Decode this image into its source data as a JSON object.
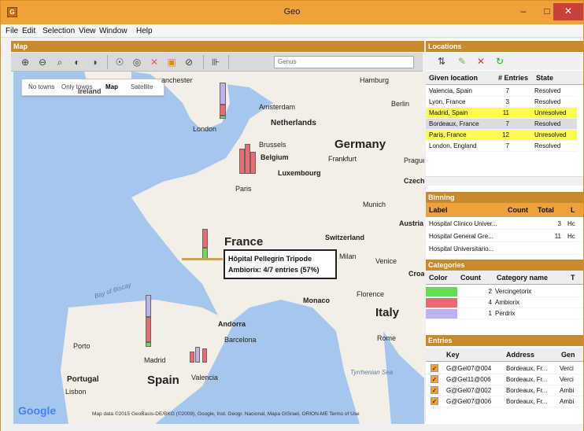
{
  "window": {
    "title": "Geo",
    "icon_label": "G",
    "minimize": "–",
    "maximize": "□",
    "close": "✕"
  },
  "menu": [
    "File",
    "Edit",
    "Selection",
    "View",
    "Window",
    "Help"
  ],
  "map_panel": {
    "title": "Map",
    "genus_placeholder": "Genus",
    "tabs": [
      "No towns",
      "Only towns",
      "Map",
      "Satellite"
    ],
    "selected_tab": "Map",
    "popup_line1": "Hôpital Pellegrin Tripode",
    "popup_line2": "Ambiorix: 4/7 entries (57%)",
    "attribution": "Map data ©2015 GeoBasis-DE/BKG (©2009), Google, Inst. Geogr. Nacional, Mapa GISrael, ORION-ME  Terms of Use",
    "google_logo": "Google",
    "places": {
      "manchester": "anchester",
      "ireland": "Ireland",
      "hamburg": "Hamburg",
      "amsterdam": "Amsterdam",
      "netherlands": "Netherlands",
      "berlin": "Berlin",
      "london": "London",
      "brussels": "Brussels",
      "belgium": "Belgium",
      "germany": "Germany",
      "frankfurt": "Frankfurt",
      "prague": "Prague",
      "luxembourg": "Luxembourg",
      "czech": "Czech",
      "paris": "Paris",
      "munich": "Munich",
      "austria": "Austria",
      "france": "France",
      "switzerland": "Switzerland",
      "milan": "Milan",
      "venice": "Venice",
      "croatia": "Croa",
      "monaco": "Monaco",
      "florence": "Florence",
      "andorra": "Andorra",
      "italy": "Italy",
      "barcelona": "Barcelona",
      "rome": "Rome",
      "porto": "Porto",
      "madrid": "Madrid",
      "portugal": "Portugal",
      "spain": "Spain",
      "valencia": "Valencia",
      "lisbon": "Lisbon",
      "tyrrhenian": "Tyrrhenian Sea",
      "biscay": "Bay of Biscay"
    }
  },
  "locations": {
    "title": "Locations",
    "columns": [
      "Given location",
      "# Entries",
      "State"
    ],
    "rows": [
      {
        "location": "Valencia, Spain",
        "entries": "7",
        "state": "Resolved"
      },
      {
        "location": "Lyon, France",
        "entries": "3",
        "state": "Resolved"
      },
      {
        "location": "Madrid, Spain",
        "entries": "11",
        "state": "Unresolved"
      },
      {
        "location": "Bordeaux, France",
        "entries": "7",
        "state": "Resolved"
      },
      {
        "location": "Paris, France",
        "entries": "12",
        "state": "Unresolved"
      },
      {
        "location": "London, England",
        "entries": "7",
        "state": "Resolved"
      }
    ]
  },
  "binning": {
    "title": "Binning",
    "columns": [
      "Label",
      "Count",
      "Total",
      "L"
    ],
    "rows": [
      {
        "label": "Hospital Clinico Univer...",
        "count": "",
        "total": "3",
        "l": "Hc"
      },
      {
        "label": "Hospital General Gre...",
        "count": "",
        "total": "11",
        "l": "Hc"
      },
      {
        "label": "Hospital Universitario...",
        "count": "",
        "total": "",
        "l": ""
      }
    ]
  },
  "categories": {
    "title": "Categories",
    "columns": [
      "Color",
      "Count",
      "Category name",
      "T"
    ],
    "rows": [
      {
        "color": "#66dd55",
        "count": "2",
        "name": "Vercingetorix"
      },
      {
        "color": "#ee6a72",
        "count": "4",
        "name": "Ambiorix"
      },
      {
        "color": "#bbb2ee",
        "count": "1",
        "name": "Perdrix"
      }
    ]
  },
  "entries": {
    "title": "Entries",
    "columns": [
      "Key",
      "Address",
      "Gen"
    ],
    "rows": [
      {
        "key": "G@Gel07@004",
        "address": "Bordeaux, Fr...",
        "gen": "Verci"
      },
      {
        "key": "G@Gel11@006",
        "address": "Bordeaux, Fr...",
        "gen": "Verci"
      },
      {
        "key": "G@Gel07@002",
        "address": "Bordeaux, Fr...",
        "gen": "Ambi"
      },
      {
        "key": "G@Gel07@006",
        "address": "Bordeaux, Fr...",
        "gen": "Ambi"
      }
    ]
  },
  "colors": {
    "panel_title": "#c9892d",
    "highlight": "#fcfc50",
    "titlebar": "#f0a23a"
  }
}
